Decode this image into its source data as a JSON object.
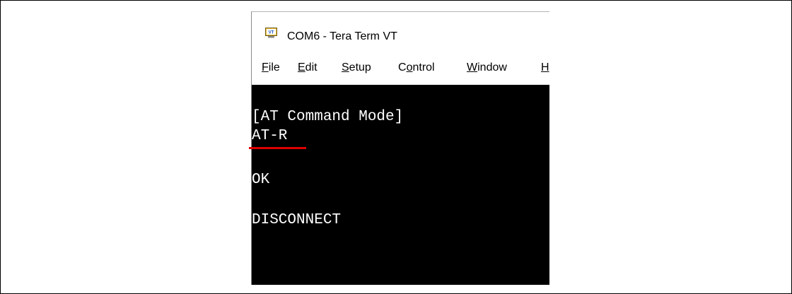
{
  "window": {
    "title": "COM6 - Tera Term VT",
    "icon": "vt-app-icon"
  },
  "menu": {
    "items": [
      {
        "mnemonic": "F",
        "rest": "ile"
      },
      {
        "mnemonic": "E",
        "rest": "dit"
      },
      {
        "mnemonic": "S",
        "rest": "etup"
      },
      {
        "pre": "C",
        "mnemonic": "o",
        "rest": "ntrol"
      },
      {
        "mnemonic": "W",
        "rest": "indow"
      },
      {
        "mnemonic": "H",
        "rest": ""
      }
    ]
  },
  "terminal": {
    "lines": [
      "[AT Command Mode]",
      "AT-R",
      "OK",
      "DISCONNECT"
    ],
    "background": "#000000",
    "text_color": "#ffffff"
  },
  "annotation": {
    "underline_color": "#e00000"
  }
}
